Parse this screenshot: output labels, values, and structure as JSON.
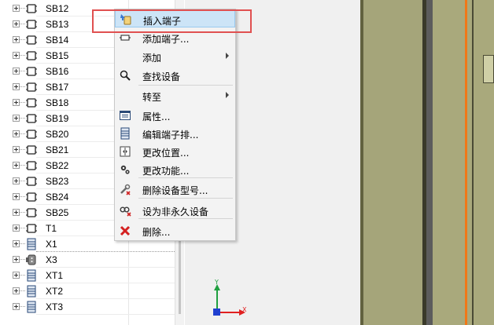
{
  "tree": {
    "items": [
      {
        "label": "SB12",
        "icon": "terminal-strip-icon"
      },
      {
        "label": "SB13",
        "icon": "terminal-strip-icon"
      },
      {
        "label": "SB14",
        "icon": "terminal-strip-icon"
      },
      {
        "label": "SB15",
        "icon": "terminal-strip-icon"
      },
      {
        "label": "SB16",
        "icon": "terminal-strip-icon"
      },
      {
        "label": "SB17",
        "icon": "terminal-strip-icon"
      },
      {
        "label": "SB18",
        "icon": "terminal-strip-icon"
      },
      {
        "label": "SB19",
        "icon": "terminal-strip-icon"
      },
      {
        "label": "SB20",
        "icon": "terminal-strip-icon"
      },
      {
        "label": "SB21",
        "icon": "terminal-strip-icon"
      },
      {
        "label": "SB22",
        "icon": "terminal-strip-icon"
      },
      {
        "label": "SB23",
        "icon": "terminal-strip-icon"
      },
      {
        "label": "SB24",
        "icon": "terminal-strip-icon"
      },
      {
        "label": "SB25",
        "icon": "terminal-strip-icon"
      },
      {
        "label": "T1",
        "icon": "terminal-strip-icon"
      },
      {
        "label": "X1",
        "icon": "terminal-block-icon",
        "selected": true
      },
      {
        "label": "X3",
        "icon": "connector-icon"
      },
      {
        "label": "XT1",
        "icon": "terminal-block-icon"
      },
      {
        "label": "XT2",
        "icon": "terminal-block-icon"
      },
      {
        "label": "XT3",
        "icon": "terminal-block-icon"
      }
    ]
  },
  "context_menu": {
    "items": [
      {
        "label": "插入端子",
        "icon": "insert-terminal-icon",
        "highlighted": true
      },
      {
        "label": "添加端子...",
        "icon": "add-terminal-icon"
      },
      {
        "label": "添加",
        "submenu": true
      },
      {
        "label": "查找设备",
        "icon": "search-icon"
      },
      {
        "label": "转至",
        "submenu": true
      },
      {
        "label": "属性...",
        "icon": "properties-icon"
      },
      {
        "label": "编辑端子排...",
        "icon": "edit-terminal-strip-icon"
      },
      {
        "label": "更改位置...",
        "icon": "change-location-icon"
      },
      {
        "label": "更改功能...",
        "icon": "gears-icon"
      },
      {
        "label": "删除设备型号...",
        "icon": "remove-model-icon"
      },
      {
        "label": "设为非永久设备",
        "icon": "non-permanent-icon"
      },
      {
        "label": "删除...",
        "icon": "delete-icon"
      }
    ]
  },
  "axis": {
    "x_label": "X",
    "y_label": "Y"
  },
  "colors": {
    "highlight_border": "#e05050",
    "menu_hover": "#cce4f7",
    "hatch_fill": "#a5a57a",
    "orange_line": "#f07818"
  }
}
